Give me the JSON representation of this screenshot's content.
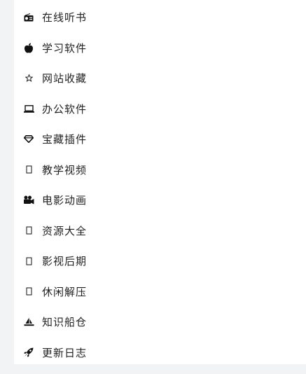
{
  "sidebar": {
    "items": [
      {
        "label": "在线听书",
        "icon": "radio-icon"
      },
      {
        "label": "学习软件",
        "icon": "apple-icon"
      },
      {
        "label": "网站收藏",
        "icon": "star-outline-icon"
      },
      {
        "label": "办公软件",
        "icon": "laptop-icon"
      },
      {
        "label": "宝藏插件",
        "icon": "diamond-icon"
      },
      {
        "label": "教学视频",
        "icon": "placeholder-box-icon"
      },
      {
        "label": "电影动画",
        "icon": "video-camera-icon"
      },
      {
        "label": "资源大全",
        "icon": "placeholder-box-icon"
      },
      {
        "label": "影视后期",
        "icon": "placeholder-box-icon"
      },
      {
        "label": "休闲解压",
        "icon": "placeholder-box-icon"
      },
      {
        "label": "知识船仓",
        "icon": "sailboat-icon"
      },
      {
        "label": "更新日志",
        "icon": "rocket-icon"
      }
    ]
  }
}
